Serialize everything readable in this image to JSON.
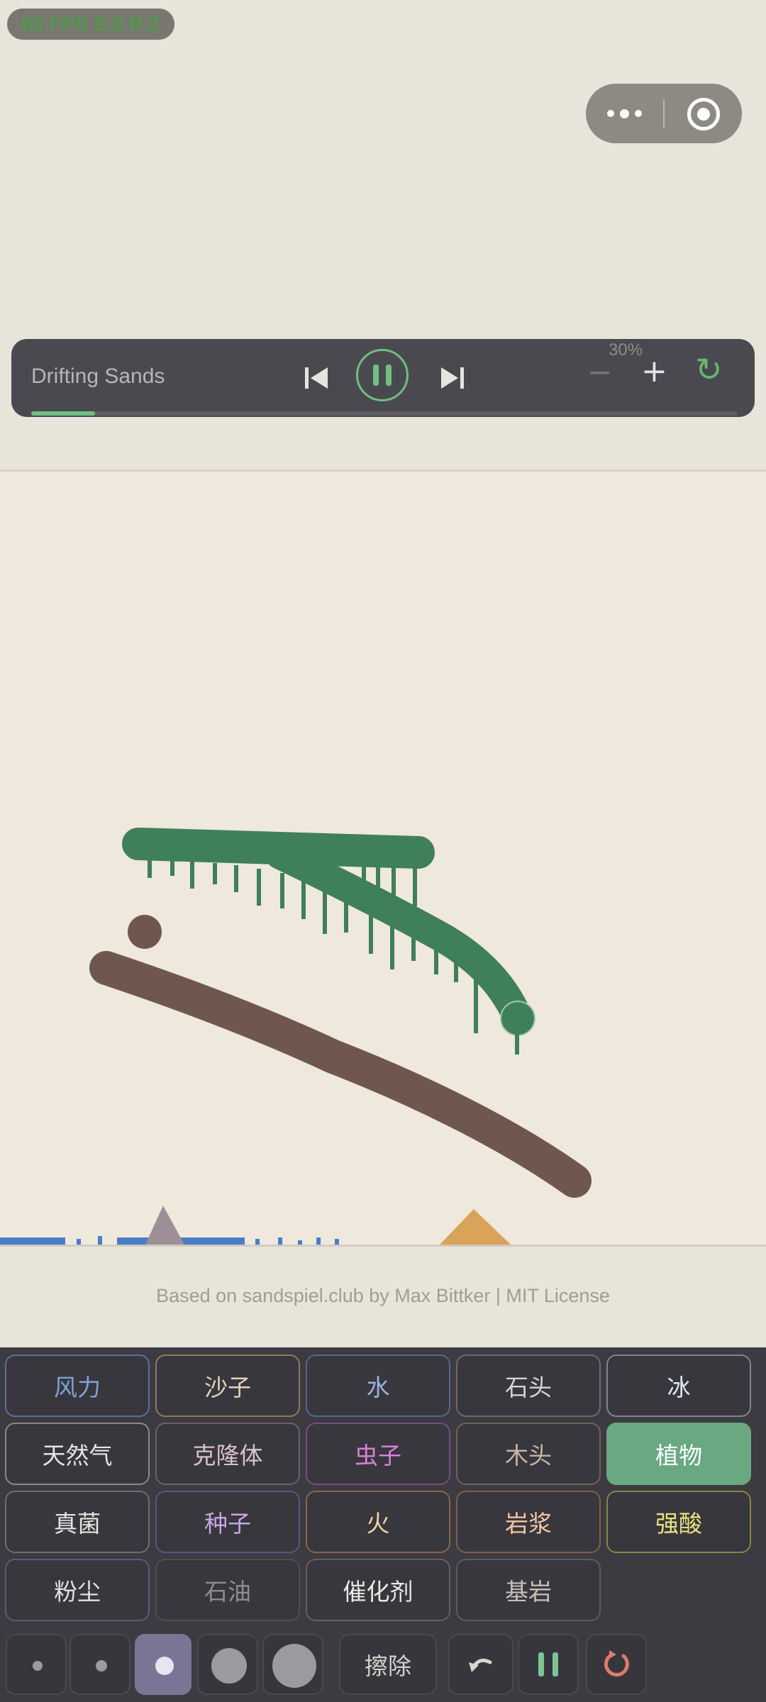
{
  "status_bar": {
    "fps_text": "60 FPS  S:0 R:2"
  },
  "capsule": {
    "more_icon": "more-dots-icon",
    "close_icon": "record-target-icon"
  },
  "player": {
    "title": "Drifting Sands",
    "speed_label": "30%",
    "progress_fraction": 0.09,
    "icons": [
      "skip-previous-icon",
      "pause-icon",
      "skip-next-icon",
      "minus-icon",
      "plus-icon",
      "refresh-icon"
    ],
    "minus_symbol": "−",
    "plus_symbol": "+",
    "refresh_symbol": "↻",
    "accent": "#6fbf80"
  },
  "credit": "Based on sandspiel.club by Max Bittker | MIT License",
  "elements": [
    {
      "label": "风力",
      "color": "#7fa2d6",
      "border": "#5e6f9a"
    },
    {
      "label": "沙子",
      "color": "#e0d2bb",
      "border": "#8e7a5c"
    },
    {
      "label": "水",
      "color": "#9ab4e0",
      "border": "#55658d"
    },
    {
      "label": "石头",
      "color": "#d6d4d0",
      "border": "#6b6a6e"
    },
    {
      "label": "冰",
      "color": "#e2e8f2",
      "border": "#7d8494"
    },
    {
      "label": "天然气",
      "color": "#e6e4e0",
      "border": "#8a888a"
    },
    {
      "label": "克隆体",
      "color": "#d6c2c8",
      "border": "#6e6068"
    },
    {
      "label": "虫子",
      "color": "#d880d8",
      "border": "#7a4a86"
    },
    {
      "label": "木头",
      "color": "#c8b4a4",
      "border": "#6e625a"
    },
    {
      "label": "植物",
      "color": "#ffffff",
      "border": "#6aa882",
      "active": true
    },
    {
      "label": "真菌",
      "color": "#e6e4e0",
      "border": "#6e6d72"
    },
    {
      "label": "种子",
      "color": "#c6a6e0",
      "border": "#5e5286"
    },
    {
      "label": "火",
      "color": "#f0d2a2",
      "border": "#86684a"
    },
    {
      "label": "岩浆",
      "color": "#f0c6a6",
      "border": "#7e5e4e"
    },
    {
      "label": "强酸",
      "color": "#e8e27e",
      "border": "#8a8446"
    },
    {
      "label": "粉尘",
      "color": "#e2dee6",
      "border": "#5a5a7e"
    },
    {
      "label": "石油",
      "color": "#8e8c8e",
      "border": "#4e4d52"
    },
    {
      "label": "催化剂",
      "color": "#ece8e4",
      "border": "#6a5e5e"
    },
    {
      "label": "基岩",
      "color": "#c8c0bc",
      "border": "#5e5a5e"
    }
  ],
  "toolbar": {
    "brush_sizes": [
      "tiny",
      "small",
      "medium",
      "large",
      "xlarge"
    ],
    "selected_brush": "medium",
    "erase_label": "擦除",
    "undo_icon": "undo-icon",
    "pause_icon": "pause-icon",
    "reset_icon": "reset-icon"
  },
  "colors": {
    "plant": "#3f7f59",
    "soil": "#6f5750",
    "water": "#4a7dc8",
    "wood_spike": "#9e8f96",
    "sand_pile": "#d9a35a",
    "selected_tool": "#7a7595"
  }
}
